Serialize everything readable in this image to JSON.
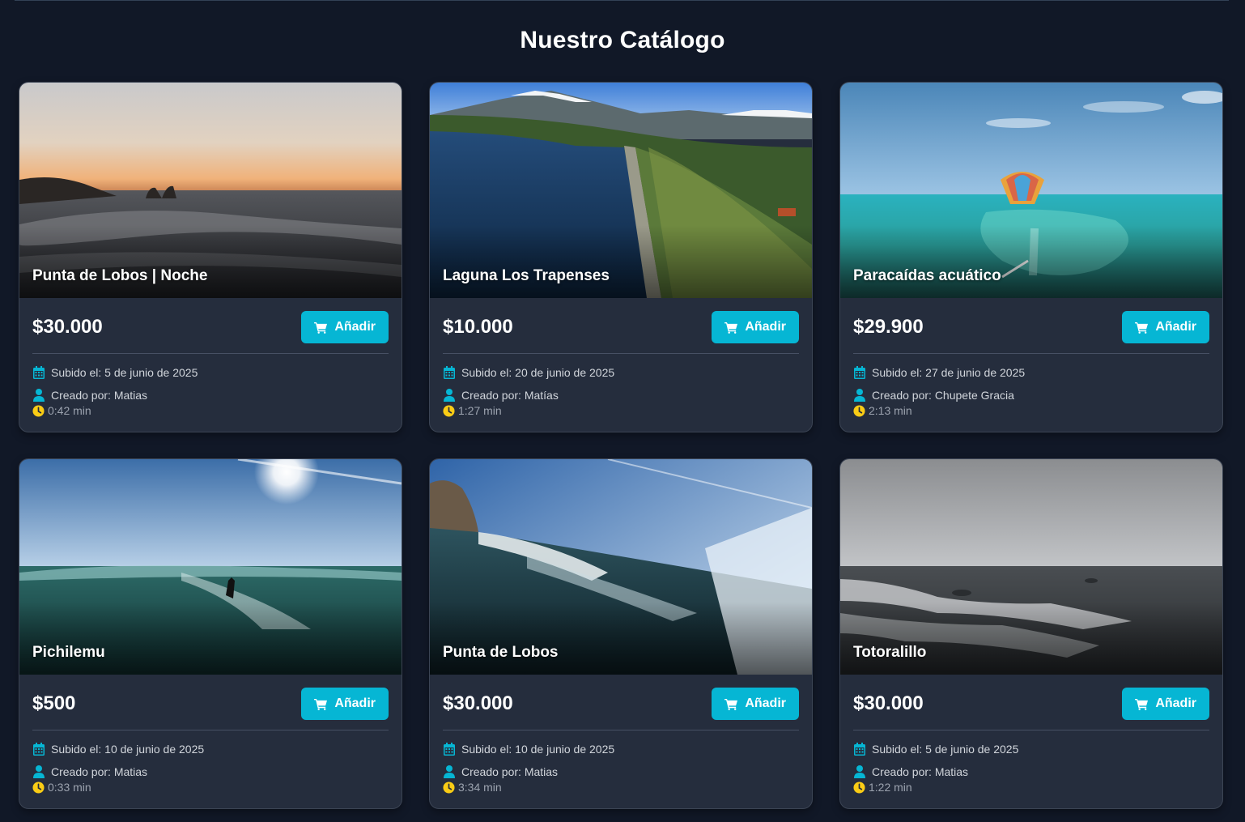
{
  "page": {
    "title": "Nuestro Catálogo"
  },
  "labels": {
    "add_button": "Añadir"
  },
  "colors": {
    "background": "#111827",
    "card": "#252d3d",
    "accent": "#06b6d4",
    "clock": "#facc15"
  },
  "icons": {
    "button": "cart-icon",
    "date": "calendar-icon",
    "creator": "user-icon",
    "duration": "clock-icon"
  },
  "cards": [
    {
      "name": "Punta de Lobos | Noche",
      "price": "$30.000",
      "uploaded": "Subido el: 5 de junio de 2025",
      "creator": "Creado por: Matias",
      "duration": "0:42 min",
      "scene": "sunset-sea"
    },
    {
      "name": "Laguna Los Trapenses",
      "price": "$10.000",
      "uploaded": "Subido el: 20 de junio de 2025",
      "creator": "Creado por: Matías",
      "duration": "1:27 min",
      "scene": "mountain-lagoon"
    },
    {
      "name": "Paracaídas acuático",
      "price": "$29.900",
      "uploaded": "Subido el: 27 de junio de 2025",
      "creator": "Creado por: Chupete Gracia",
      "duration": "2:13 min",
      "scene": "parasail-turquoise"
    },
    {
      "name": "Pichilemu",
      "price": "$500",
      "uploaded": "Subido el: 10 de junio de 2025",
      "creator": "Creado por: Matias",
      "duration": "0:33 min",
      "scene": "surfer-sun"
    },
    {
      "name": "Punta de Lobos",
      "price": "$30.000",
      "uploaded": "Subido el: 10 de junio de 2025",
      "creator": "Creado por: Matias",
      "duration": "3:34 min",
      "scene": "tilted-wave-rock"
    },
    {
      "name": "Totoralillo",
      "price": "$30.000",
      "uploaded": "Subido el: 5 de junio de 2025",
      "creator": "Creado por: Matias",
      "duration": "1:22 min",
      "scene": "grey-sea"
    }
  ]
}
